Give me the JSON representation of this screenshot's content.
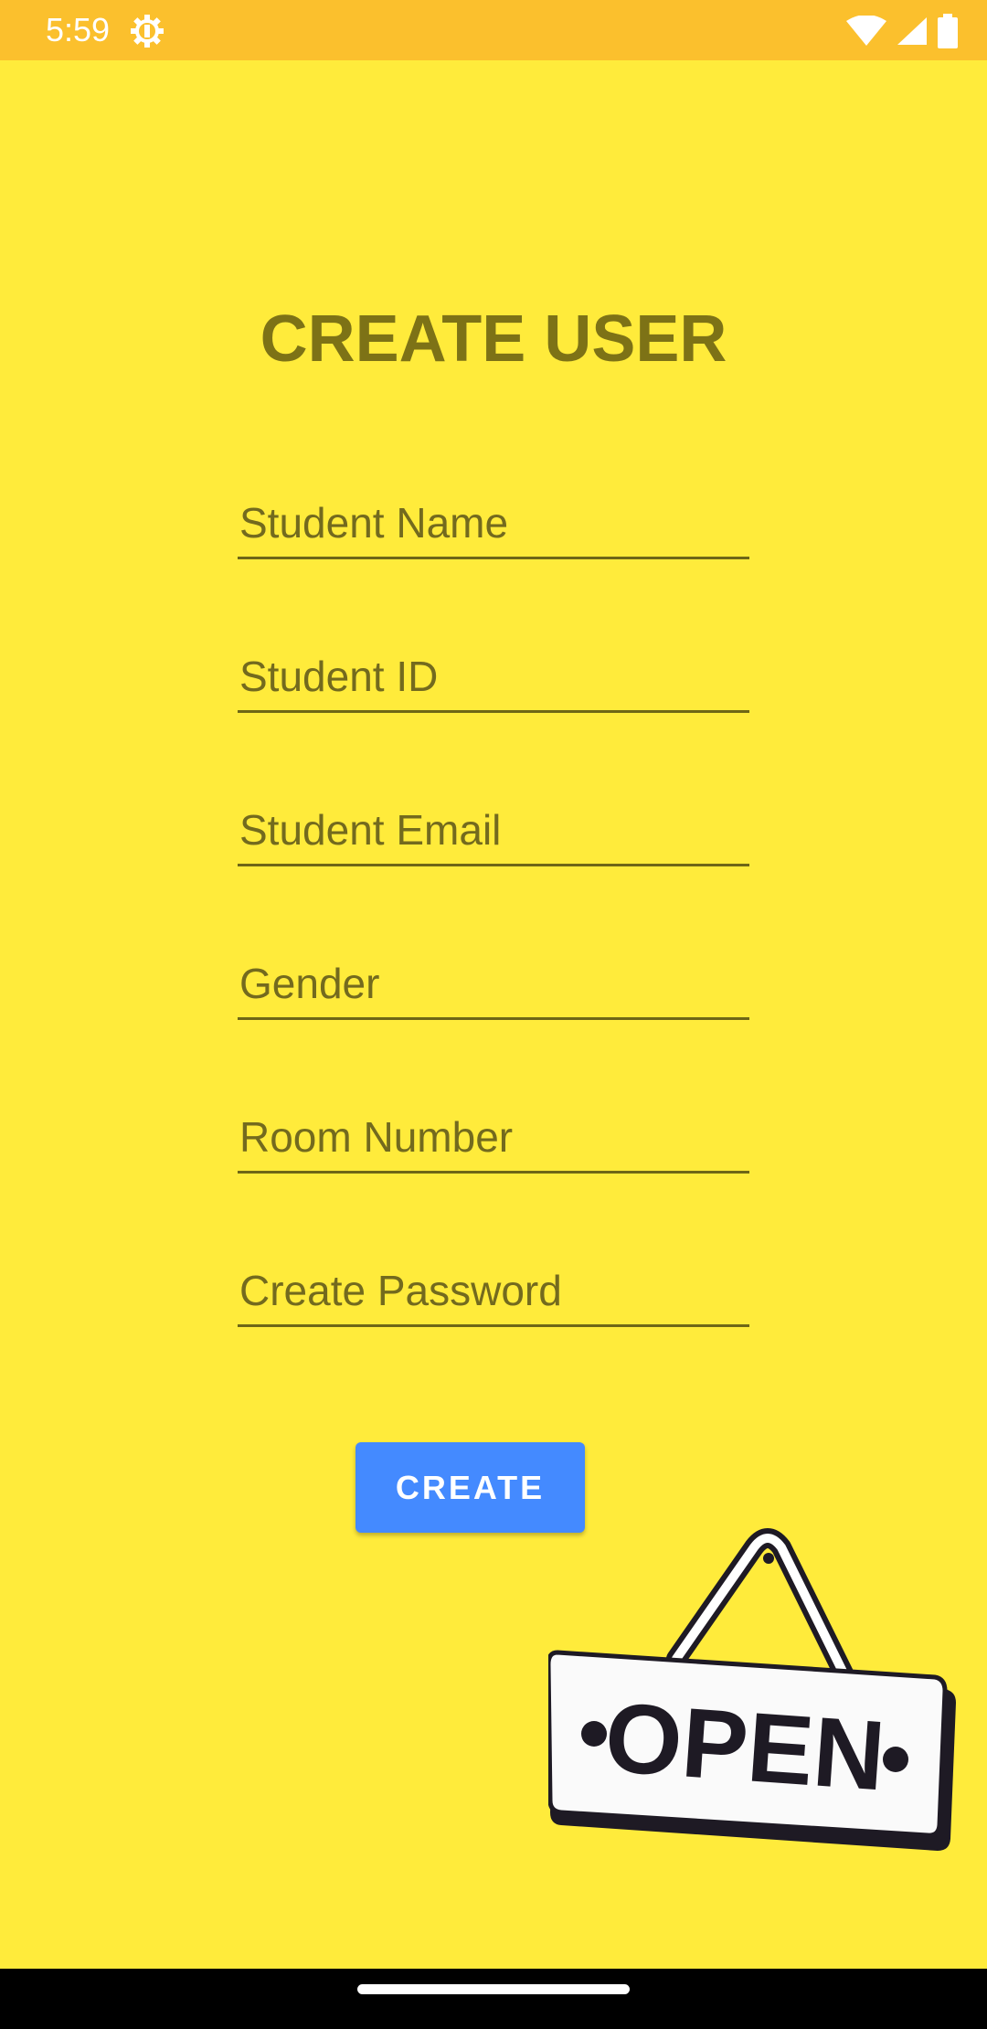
{
  "status_bar": {
    "time": "5:59",
    "icons": [
      "settings-gear-icon",
      "wifi-icon",
      "signal-icon",
      "battery-icon"
    ],
    "background": "#FBC02D"
  },
  "screen": {
    "background": "#FFEB3B",
    "title": "CREATE USER",
    "title_color": "#7D7216"
  },
  "form": {
    "fields": [
      {
        "hint": "Student Name",
        "value": ""
      },
      {
        "hint": "Student ID",
        "value": ""
      },
      {
        "hint": "Student Email",
        "value": ""
      },
      {
        "hint": "Gender",
        "value": ""
      },
      {
        "hint": "Room Number",
        "value": ""
      },
      {
        "hint": "Create Password",
        "value": ""
      }
    ],
    "submit_label": "CREATE",
    "submit_color": "#448AFF"
  },
  "sign": {
    "text": "OPEN"
  }
}
